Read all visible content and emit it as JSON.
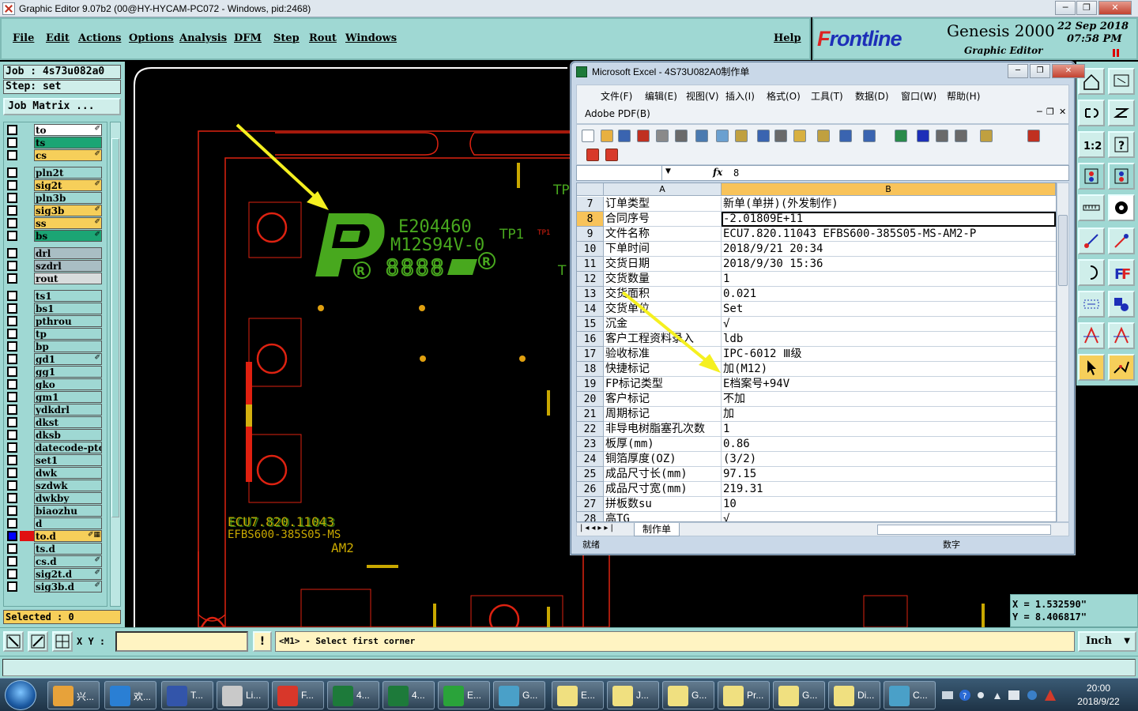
{
  "window": {
    "title": "Graphic Editor 9.07b2 (00@HY-HYCAM-PC072 - Windows, pid:2468)",
    "min": "─",
    "max": "❐",
    "close": "✕"
  },
  "menu": {
    "file": "File",
    "edit": "Edit",
    "actions": "Actions",
    "options": "Options",
    "analysis": "Analysis",
    "dfm": "DFM",
    "step": "Step",
    "rout": "Rout",
    "windows": "Windows",
    "help": "Help"
  },
  "brand": {
    "logo": "Frontline",
    "product": "Genesis 2000",
    "subtitle": "Graphic Editor",
    "date": "22 Sep 2018",
    "time": "07:58 PM"
  },
  "job": {
    "job_line": "Job : 4s73u082a0",
    "step_line": "Step: set",
    "matrix_button": "Job Matrix ...",
    "selected": "Selected : 0"
  },
  "layers": [
    {
      "name": "to",
      "color": "#ffffff",
      "mark": "✐"
    },
    {
      "name": "ts",
      "color": "#1ba574",
      "mark": ""
    },
    {
      "name": "cs",
      "color": "#f6cf5a",
      "mark": "✐"
    },
    {
      "name": "pln2t",
      "color": "#9fd8d3",
      "mark": ""
    },
    {
      "name": "sig2t",
      "color": "#f6cf5a",
      "mark": "✐"
    },
    {
      "name": "pln3b",
      "color": "#9fd8d3",
      "mark": ""
    },
    {
      "name": "sig3b",
      "color": "#f6cf5a",
      "mark": "✐"
    },
    {
      "name": "ss",
      "color": "#f6cf5a",
      "mark": "✐"
    },
    {
      "name": "bs",
      "color": "#1ba574",
      "mark": "✐"
    },
    {
      "name": "drl",
      "color": "#a9bec4",
      "mark": ""
    },
    {
      "name": "szdrl",
      "color": "#a9bec4",
      "mark": ""
    },
    {
      "name": "rout",
      "color": "#d8dcdc",
      "mark": ""
    },
    {
      "name": "ts1",
      "color": "#9fd8d3",
      "mark": ""
    },
    {
      "name": "bs1",
      "color": "#9fd8d3",
      "mark": ""
    },
    {
      "name": "pthrou",
      "color": "#9fd8d3",
      "mark": ""
    },
    {
      "name": "tp",
      "color": "#9fd8d3",
      "mark": ""
    },
    {
      "name": "bp",
      "color": "#9fd8d3",
      "mark": ""
    },
    {
      "name": "gd1",
      "color": "#9fd8d3",
      "mark": "✐"
    },
    {
      "name": "gg1",
      "color": "#9fd8d3",
      "mark": ""
    },
    {
      "name": "gko",
      "color": "#9fd8d3",
      "mark": ""
    },
    {
      "name": "gm1",
      "color": "#9fd8d3",
      "mark": ""
    },
    {
      "name": "ydkdrl",
      "color": "#9fd8d3",
      "mark": ""
    },
    {
      "name": "dkst",
      "color": "#9fd8d3",
      "mark": ""
    },
    {
      "name": "dksb",
      "color": "#9fd8d3",
      "mark": ""
    },
    {
      "name": "datecode-ptc",
      "color": "#9fd8d3",
      "mark": ""
    },
    {
      "name": "set1",
      "color": "#9fd8d3",
      "mark": ""
    },
    {
      "name": "dwk",
      "color": "#9fd8d3",
      "mark": ""
    },
    {
      "name": "szdwk",
      "color": "#9fd8d3",
      "mark": ""
    },
    {
      "name": "dwkby",
      "color": "#9fd8d3",
      "mark": ""
    },
    {
      "name": "biaozhu",
      "color": "#9fd8d3",
      "mark": ""
    },
    {
      "name": "d",
      "color": "#9fd8d3",
      "mark": ""
    },
    {
      "name": "to.d",
      "color": "#f6cf5a",
      "mark": "✐▦"
    },
    {
      "name": "ts.d",
      "color": "#9fd8d3",
      "mark": ""
    },
    {
      "name": "cs.d",
      "color": "#9fd8d3",
      "mark": "✐"
    },
    {
      "name": "sig2t.d",
      "color": "#9fd8d3",
      "mark": "✐"
    },
    {
      "name": "sig3b.d",
      "color": "#9fd8d3",
      "mark": "✐"
    }
  ],
  "canvas": {
    "ul_number": "E204460",
    "material": "M12S94V-0",
    "date_code": "8888",
    "tp1_green": "TP1",
    "tp1_red": "TP1",
    "tp_cut": "TP",
    "t_cut": "T",
    "part_line1": "ECU7.820.11043",
    "part_line2": "EFBS600-385S05-MS",
    "part_line3": "AM2"
  },
  "coords": {
    "x": "X = 1.532590\"",
    "y": "Y = 8.406817\""
  },
  "cmd": {
    "xy_label": "X Y :",
    "xy_value": "",
    "warn": "!",
    "prompt": "<M1> - Select first corner",
    "unit": "Inch"
  },
  "excel": {
    "title": "Microsoft Excel - 4S73U082A0制作单",
    "menus": [
      "文件(F)",
      "编辑(E)",
      "视图(V)",
      "插入(I)",
      "格式(O)",
      "工具(T)",
      "数据(D)",
      "窗口(W)",
      "帮助(H)"
    ],
    "adobe": "Adobe PDF(B)",
    "name_box": "",
    "fx": "fx",
    "formula": "8",
    "col_a": "A",
    "col_b": "B",
    "rows": [
      {
        "n": "7",
        "a": "订单类型",
        "b": "新单(单拼)(外发制作)"
      },
      {
        "n": "8",
        "a": "合同序号",
        "b": "-2.01809E+11"
      },
      {
        "n": "9",
        "a": "文件名称",
        "b": "ECU7.820.11043 EFBS600-385S05-MS-AM2-P"
      },
      {
        "n": "10",
        "a": "下单时间",
        "b": "2018/9/21 20:34"
      },
      {
        "n": "11",
        "a": "交货日期",
        "b": "2018/9/30 15:36"
      },
      {
        "n": "12",
        "a": "交货数量",
        "b": "1"
      },
      {
        "n": "13",
        "a": "交货面积",
        "b": "0.021"
      },
      {
        "n": "14",
        "a": "交货单位",
        "b": "Set"
      },
      {
        "n": "15",
        "a": "沉金",
        "b": "√"
      },
      {
        "n": "16",
        "a": "客户工程资料录入",
        "b": "ldb"
      },
      {
        "n": "17",
        "a": "验收标准",
        "b": "IPC-6012 Ⅲ级"
      },
      {
        "n": "18",
        "a": "快捷标记",
        "b": "加(M12)"
      },
      {
        "n": "19",
        "a": "FP标记类型",
        "b": "E档案号+94V"
      },
      {
        "n": "20",
        "a": "客户标记",
        "b": "不加"
      },
      {
        "n": "21",
        "a": "周期标记",
        "b": "加"
      },
      {
        "n": "22",
        "a": "非导电树脂塞孔次数",
        "b": "1"
      },
      {
        "n": "23",
        "a": "板厚(mm)",
        "b": "0.86"
      },
      {
        "n": "24",
        "a": "铜箔厚度(OZ)",
        "b": "(3/2)"
      },
      {
        "n": "25",
        "a": "成品尺寸长(mm)",
        "b": "97.15"
      },
      {
        "n": "26",
        "a": "成品尺寸宽(mm)",
        "b": "219.31"
      },
      {
        "n": "27",
        "a": "拼板数su",
        "b": "10"
      },
      {
        "n": "28",
        "a": "高TG",
        "b": "√"
      }
    ],
    "sheet_tab": "制作单",
    "status_left": "就绪",
    "status_num": "数字"
  },
  "taskbar": {
    "items": [
      {
        "label": "兴...",
        "color": "#e7a23a"
      },
      {
        "label": "欢...",
        "color": "#2a7fd4"
      },
      {
        "label": "T...",
        "color": "#3355aa"
      },
      {
        "label": "Li...",
        "color": "#c9c9c9"
      },
      {
        "label": "F...",
        "color": "#d8372a"
      },
      {
        "label": "4...",
        "color": "#1d7a3a"
      },
      {
        "label": "4...",
        "color": "#1d7a3a"
      },
      {
        "label": "E...",
        "color": "#2aa33a"
      },
      {
        "label": "G...",
        "color": "#4aa0c8"
      },
      {
        "label": "E...",
        "color": "#f0e080"
      },
      {
        "label": "J...",
        "color": "#f0e080"
      },
      {
        "label": "G...",
        "color": "#f0e080"
      },
      {
        "label": "Pr...",
        "color": "#f0e080"
      },
      {
        "label": "G...",
        "color": "#f0e080"
      },
      {
        "label": "Di...",
        "color": "#f0e080"
      },
      {
        "label": "C...",
        "color": "#4aa0c8"
      }
    ],
    "time": "20:00",
    "date": "2018/9/22"
  }
}
